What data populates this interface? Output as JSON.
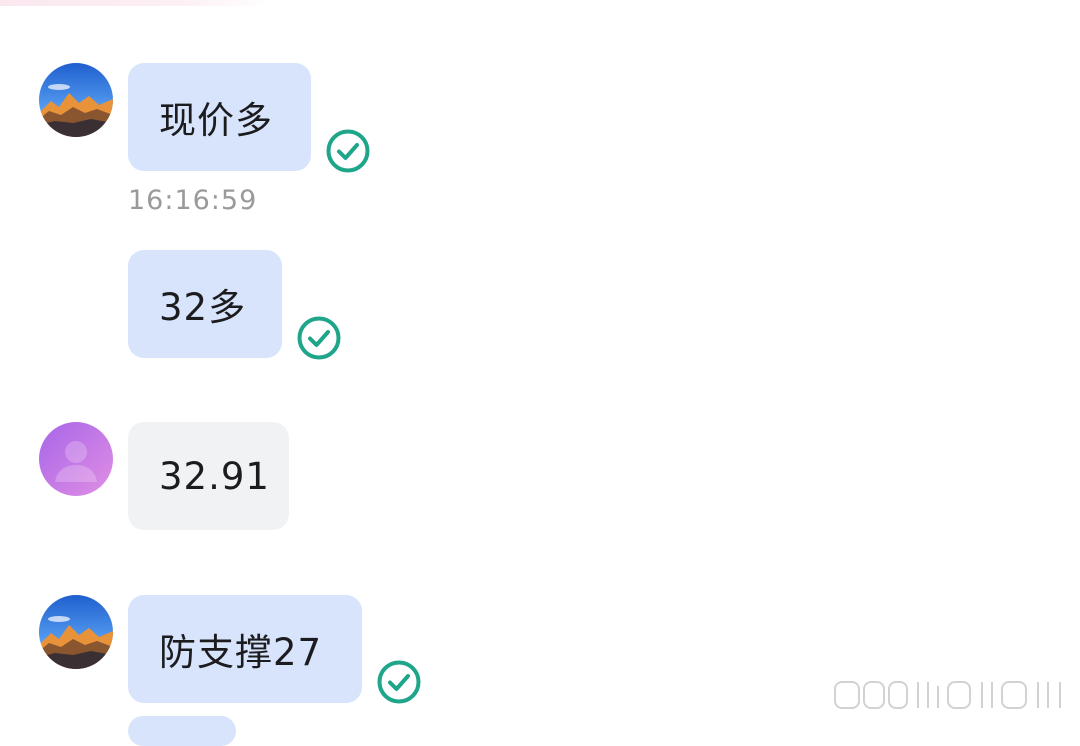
{
  "chat": {
    "messages": [
      {
        "sender": "me",
        "text": "现价多",
        "status": "read"
      },
      {
        "sender": "me",
        "text": "32多",
        "status": "read"
      },
      {
        "sender": "other",
        "text": "32.91"
      },
      {
        "sender": "me",
        "text": "防支撑27",
        "status": "read"
      }
    ],
    "timestamp": "16:16:59"
  },
  "colors": {
    "my_bubble": "#d7e4fb",
    "other_bubble": "#f1f2f4",
    "read_check": "#1fa58a",
    "timestamp_text": "#9a9a9a"
  },
  "icons": {
    "read_status": "check-circle-icon",
    "my_avatar": "mountain-avatar-icon",
    "other_avatar": "person-placeholder-icon"
  }
}
